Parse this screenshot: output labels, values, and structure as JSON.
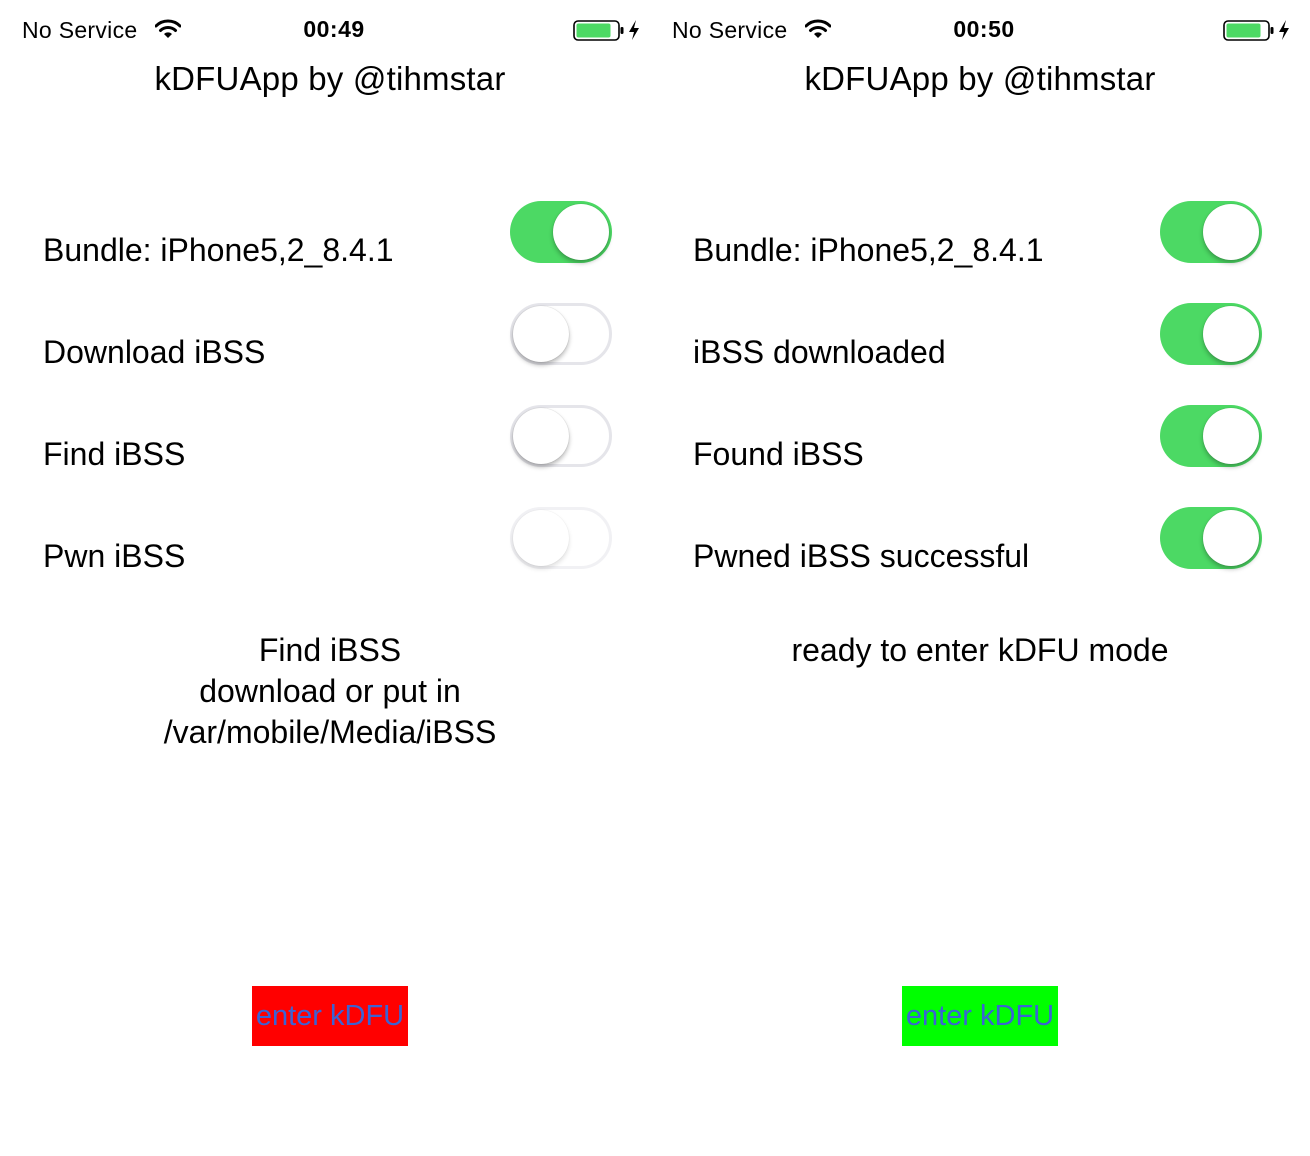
{
  "colors": {
    "toggle_on": "#4cd964",
    "toggle_off_border": "#e5e5ea",
    "battery_fill": "#4cd964",
    "button_text": "#3b63d4",
    "button_bg_left": "#ff0000",
    "button_bg_right": "#00ff00"
  },
  "screens": [
    {
      "status_bar": {
        "carrier": "No Service",
        "time": "00:49",
        "wifi_icon": "wifi-icon",
        "battery_icon": "battery-charging-icon",
        "battery_level": 0.85
      },
      "title": "kDFUApp by @tihmstar",
      "rows": [
        {
          "label": "Bundle: iPhone5,2_8.4.1",
          "on": true
        },
        {
          "label": "Download iBSS",
          "on": false
        },
        {
          "label": "Find iBSS",
          "on": false
        },
        {
          "label": "Pwn iBSS",
          "on": false
        }
      ],
      "message_lines": [
        "Find iBSS",
        "download or put in",
        "/var/mobile/Media/iBSS"
      ],
      "button": {
        "label": "enter kDFU",
        "color": "red"
      }
    },
    {
      "status_bar": {
        "carrier": "No Service",
        "time": "00:50",
        "wifi_icon": "wifi-icon",
        "battery_icon": "battery-charging-icon",
        "battery_level": 0.85
      },
      "title": "kDFUApp by @tihmstar",
      "rows": [
        {
          "label": "Bundle: iPhone5,2_8.4.1",
          "on": true
        },
        {
          "label": "iBSS downloaded",
          "on": true
        },
        {
          "label": "Found iBSS",
          "on": true
        },
        {
          "label": "Pwned iBSS successful",
          "on": true
        }
      ],
      "message_lines": [
        "ready to enter kDFU mode"
      ],
      "button": {
        "label": "enter kDFU",
        "color": "green"
      }
    }
  ]
}
